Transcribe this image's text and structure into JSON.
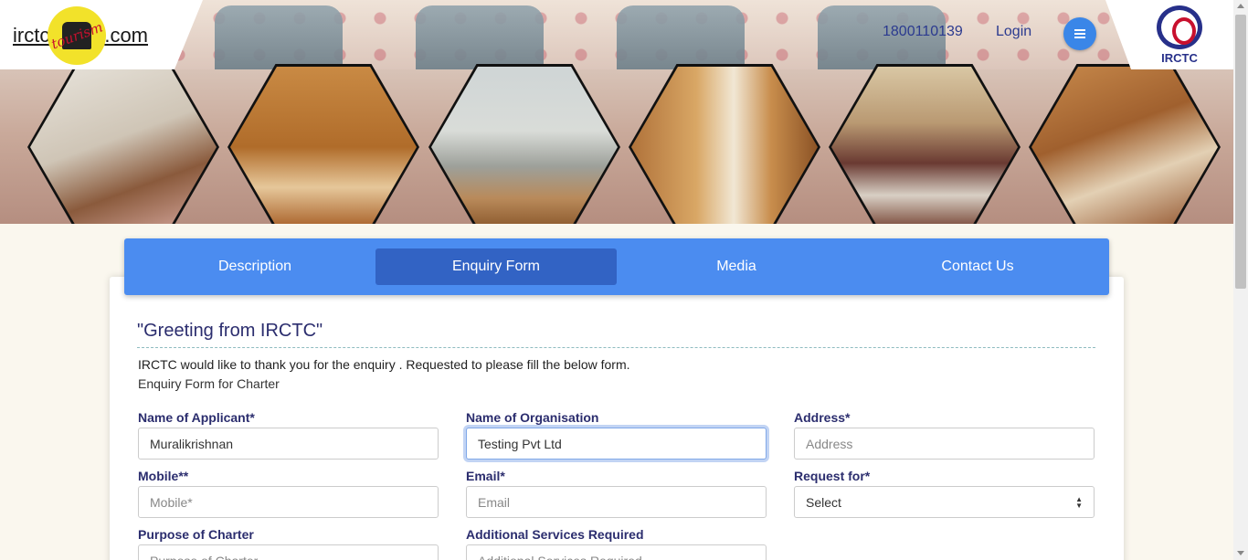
{
  "header": {
    "logo": {
      "left_text": "irctc",
      "badge_text": "tourism",
      "right_text": ".com"
    },
    "phone": "1800110139",
    "login_label": "Login",
    "menu_icon": "hamburger-menu-icon",
    "irctc_caption": "IRCTC"
  },
  "banner": {
    "images": [
      "hotel-room-interior",
      "twin-bed-cabin",
      "train-window-track-view",
      "train-corridor",
      "lounge-sofa",
      "dining-cabin"
    ]
  },
  "tabs": [
    {
      "label": "Description",
      "active": false
    },
    {
      "label": "Enquiry Form",
      "active": true
    },
    {
      "label": "Media",
      "active": false
    },
    {
      "label": "Contact Us",
      "active": false
    }
  ],
  "form": {
    "greeting": "\"Greeting from IRCTC\"",
    "intro_line1": "IRCTC would like to thank you for the enquiry . Requested to please fill the below form.",
    "intro_line2": "Enquiry Form for Charter",
    "fields": {
      "applicant": {
        "label": "Name of Applicant*",
        "value": "Muralikrishnan",
        "placeholder": ""
      },
      "organisation": {
        "label": "Name of Organisation",
        "value": "Testing Pvt Ltd",
        "placeholder": ""
      },
      "address": {
        "label": "Address*",
        "value": "",
        "placeholder": "Address"
      },
      "mobile": {
        "label": "Mobile**",
        "value": "",
        "placeholder": "Mobile*"
      },
      "email": {
        "label": "Email*",
        "value": "",
        "placeholder": "Email"
      },
      "request_for": {
        "label": "Request for*",
        "selected": "Select"
      },
      "purpose": {
        "label": "Purpose of Charter",
        "value": "",
        "placeholder": "Purpose of Charter"
      },
      "services": {
        "label": "Additional Services Required",
        "value": "",
        "placeholder": "Additional Services Required"
      }
    }
  },
  "colors": {
    "tab_bar": "#4b8cf0",
    "tab_active": "#3263c4",
    "navy_text": "#2b2d6e",
    "menu_button": "#3a86e8",
    "page_bg": "#faf7ee"
  }
}
